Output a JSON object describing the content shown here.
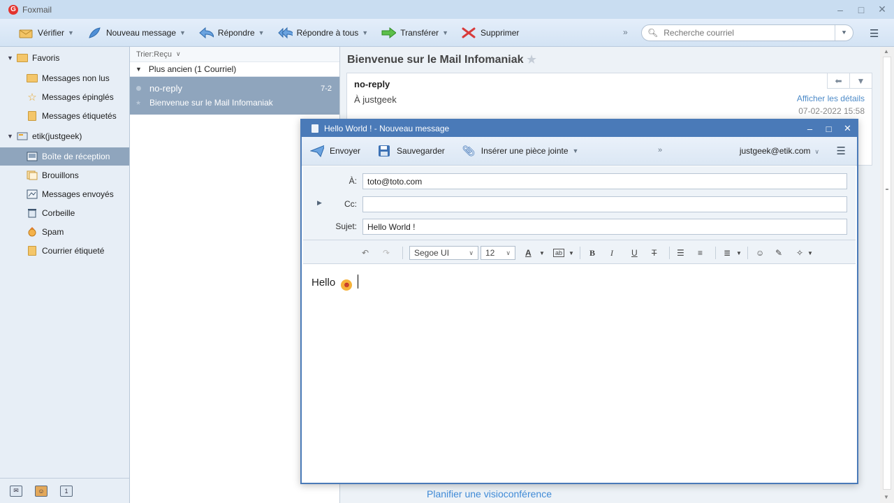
{
  "app": {
    "title": "Foxmail",
    "logo_letter": "G"
  },
  "toolbar": {
    "buttons": [
      {
        "label": "Vérifier",
        "icon": "inbox-check-icon",
        "has_menu": true
      },
      {
        "label": "Nouveau message",
        "icon": "feather-pen-icon",
        "has_menu": true
      },
      {
        "label": "Répondre",
        "icon": "reply-icon",
        "has_menu": true
      },
      {
        "label": "Répondre à tous",
        "icon": "reply-all-icon",
        "has_menu": true
      },
      {
        "label": "Transférer",
        "icon": "forward-icon",
        "has_menu": true
      },
      {
        "label": "Supprimer",
        "icon": "delete-icon",
        "has_menu": false
      }
    ],
    "more": "»",
    "search_placeholder": "Recherche courriel"
  },
  "sidebar": {
    "favorites_label": "Favoris",
    "favorites": [
      {
        "label": "Messages non lus",
        "icon": "folder-icon"
      },
      {
        "label": "Messages épinglés",
        "icon": "star-icon"
      },
      {
        "label": "Messages étiquetés",
        "icon": "tag-folder-icon"
      }
    ],
    "account_label": "etik(justgeek)",
    "folders": [
      {
        "label": "Boîte de réception",
        "icon": "inbox-icon",
        "active": true
      },
      {
        "label": "Brouillons",
        "icon": "drafts-icon"
      },
      {
        "label": "Messages envoyés",
        "icon": "sent-icon"
      },
      {
        "label": "Corbeille",
        "icon": "trash-icon"
      },
      {
        "label": "Spam",
        "icon": "spam-icon"
      },
      {
        "label": "Courrier étiqueté",
        "icon": "tag-folder-icon"
      }
    ],
    "bottom_icons": [
      "mail-icon",
      "contacts-icon",
      "calendar-icon"
    ]
  },
  "list": {
    "sort_label": "Trier:Reçu",
    "group_label": "Plus ancien  (1 Courriel)",
    "messages": [
      {
        "from": "no-reply",
        "date": "7-2",
        "subject": "Bienvenue sur le Mail Infomaniak"
      }
    ]
  },
  "reader": {
    "title": "Bienvenue sur le Mail Infomaniak",
    "from": "no-reply",
    "to": "À justgeek",
    "details_link": "Afficher les détails",
    "date": "07-02-2022 15:58",
    "visio_link": "Planifier une visioconférence"
  },
  "compose": {
    "title": "Hello World ! - Nouveau message",
    "buttons": [
      {
        "label": "Envoyer",
        "icon": "send-icon"
      },
      {
        "label": "Sauvegarder",
        "icon": "save-icon"
      },
      {
        "label": "Insérer une pièce jointe",
        "icon": "paperclip-icon"
      }
    ],
    "more": "»",
    "account": "justgeek@etik.com",
    "to_label": "À:",
    "to_value": "toto@toto.com",
    "cc_label": "Cc:",
    "cc_value": "",
    "subject_label": "Sujet:",
    "subject_value": "Hello World !",
    "font_name": "Segoe UI",
    "font_size": "12",
    "body_text": "Hello"
  }
}
